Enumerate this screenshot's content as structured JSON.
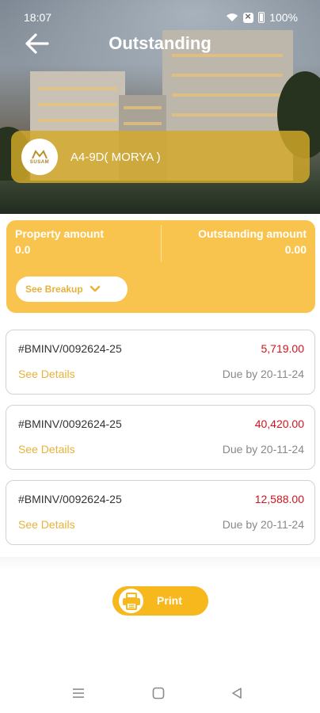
{
  "status": {
    "time": "18:07",
    "battery": "100%",
    "icons": [
      "wifi-icon",
      "xbox-icon",
      "battery-icon"
    ]
  },
  "header": {
    "title": "Outstanding",
    "back_icon": "arrow-left-icon"
  },
  "property": {
    "logo_text": "SUSAM",
    "name": "A4-9D( MORYA )"
  },
  "summary": {
    "property_amount_label": "Property amount",
    "property_amount_value": "0.0",
    "outstanding_amount_label": "Outstanding amount",
    "outstanding_amount_value": "0.00",
    "breakup_label": "See Breakup"
  },
  "invoices": [
    {
      "number": "#BMINV/0092624-25",
      "amount": "5,719.00",
      "details_label": "See Details",
      "due": "Due by 20-11-24"
    },
    {
      "number": "#BMINV/0092624-25",
      "amount": "40,420.00",
      "details_label": "See Details",
      "due": "Due by 20-11-24"
    },
    {
      "number": "#BMINV/0092624-25",
      "amount": "12,588.00",
      "details_label": "See Details",
      "due": "Due by 20-11-24"
    }
  ],
  "actions": {
    "print_label": "Print"
  },
  "colors": {
    "accent": "#f9c44d",
    "button": "#f7b81d",
    "amount_red": "#d0131c",
    "link_gold": "#e7b23a"
  }
}
